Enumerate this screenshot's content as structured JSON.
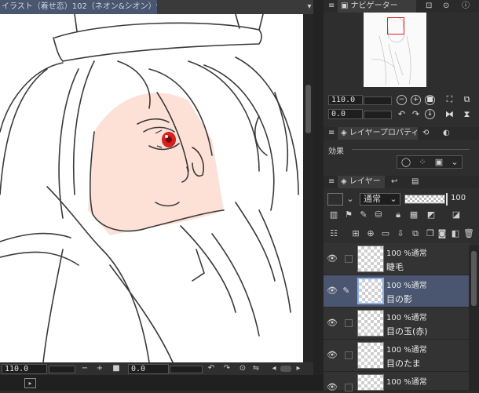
{
  "document_tab": {
    "title": "イラスト（着せ恋）102（ネオン&シオン）*",
    "dropdown_icon": "chevron-down-icon"
  },
  "canvas_bottom": {
    "zoom": "110.0",
    "rotation": "0.0",
    "minus_label": "−",
    "plus_label": "+"
  },
  "navigator": {
    "tab_label": "ナビゲーター",
    "zoom": "110.0",
    "rotation": "0.0",
    "frame_color": "#e02020"
  },
  "layer_property": {
    "tab_label": "レイヤープロパティ",
    "effect_label": "効果"
  },
  "layers_panel": {
    "tab_label": "レイヤー",
    "blend_mode": "通常",
    "opacity": "100",
    "layers": [
      {
        "mode": "100 %通常",
        "name": "睫毛",
        "selected": false,
        "editing": false
      },
      {
        "mode": "100 %通常",
        "name": "目の影",
        "selected": true,
        "editing": true
      },
      {
        "mode": "100 %通常",
        "name": "目の玉(赤)",
        "selected": false,
        "editing": false
      },
      {
        "mode": "100 %通常",
        "name": "目のたま",
        "selected": false,
        "editing": false
      },
      {
        "mode": "100 %通常",
        "name": "",
        "selected": false,
        "editing": false
      }
    ]
  },
  "colors": {
    "selection": "#4a5670",
    "skin": "#fde1d6",
    "iris": "#d92020"
  }
}
